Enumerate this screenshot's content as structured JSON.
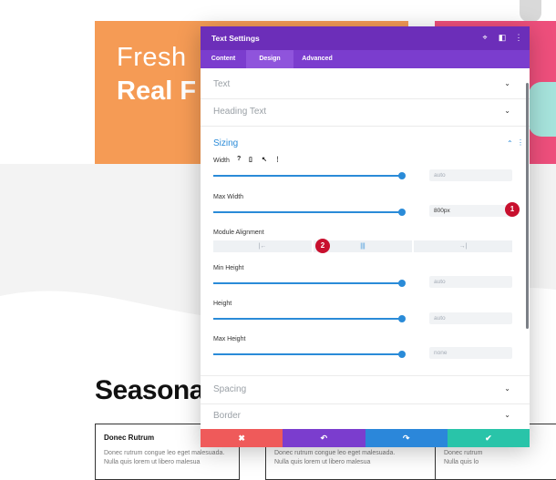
{
  "page": {
    "hero_line1": "Fresh",
    "hero_line2": "Real F",
    "seasonal_heading": "Seasona",
    "cards": [
      {
        "title": "Donec Rutrum",
        "line1": "Donec rutrum congue leo eget malesuada.",
        "line2": "Nulla quis lorem ut libero malesua"
      },
      {
        "title": "",
        "line1": "Donec rutrum congue leo eget malesuada.",
        "line2": "Nulla quis lorem ut libero malesua"
      },
      {
        "title": "",
        "line1": "Donec rutrum",
        "line2": "Nulla quis lo"
      }
    ]
  },
  "modal": {
    "title": "Text Settings",
    "header_icons": [
      "target-icon",
      "sidebar-toggle-icon",
      "more-vertical-icon"
    ],
    "tabs": [
      {
        "label": "Content",
        "active": false
      },
      {
        "label": "Design",
        "active": true
      },
      {
        "label": "Advanced",
        "active": false
      }
    ],
    "sections_top": [
      {
        "label": "Text"
      },
      {
        "label": "Heading Text"
      }
    ],
    "sizing": {
      "label": "Sizing",
      "width": {
        "label": "Width",
        "placeholder": "auto",
        "icons": [
          "?",
          "▯",
          "↖",
          "⋮"
        ]
      },
      "max_width": {
        "label": "Max Width",
        "value": "800px"
      },
      "module_alignment": {
        "label": "Module Alignment",
        "options": [
          "|←",
          "|||",
          "→|"
        ],
        "active_index": 1
      },
      "min_height": {
        "label": "Min Height",
        "placeholder": "auto"
      },
      "height": {
        "label": "Height",
        "placeholder": "auto"
      },
      "max_height": {
        "label": "Max Height",
        "placeholder": "none"
      }
    },
    "sections_bottom": [
      {
        "label": "Spacing"
      },
      {
        "label": "Border"
      }
    ],
    "badges": [
      "1",
      "2"
    ],
    "footer": {
      "cancel_icon": "✖",
      "undo_icon": "↶",
      "redo_icon": "↷",
      "save_icon": "✔",
      "colors": {
        "cancel": "#ef5a5a",
        "undo": "#7b3dce",
        "redo": "#2b87da",
        "save": "#29c4a9"
      }
    }
  }
}
